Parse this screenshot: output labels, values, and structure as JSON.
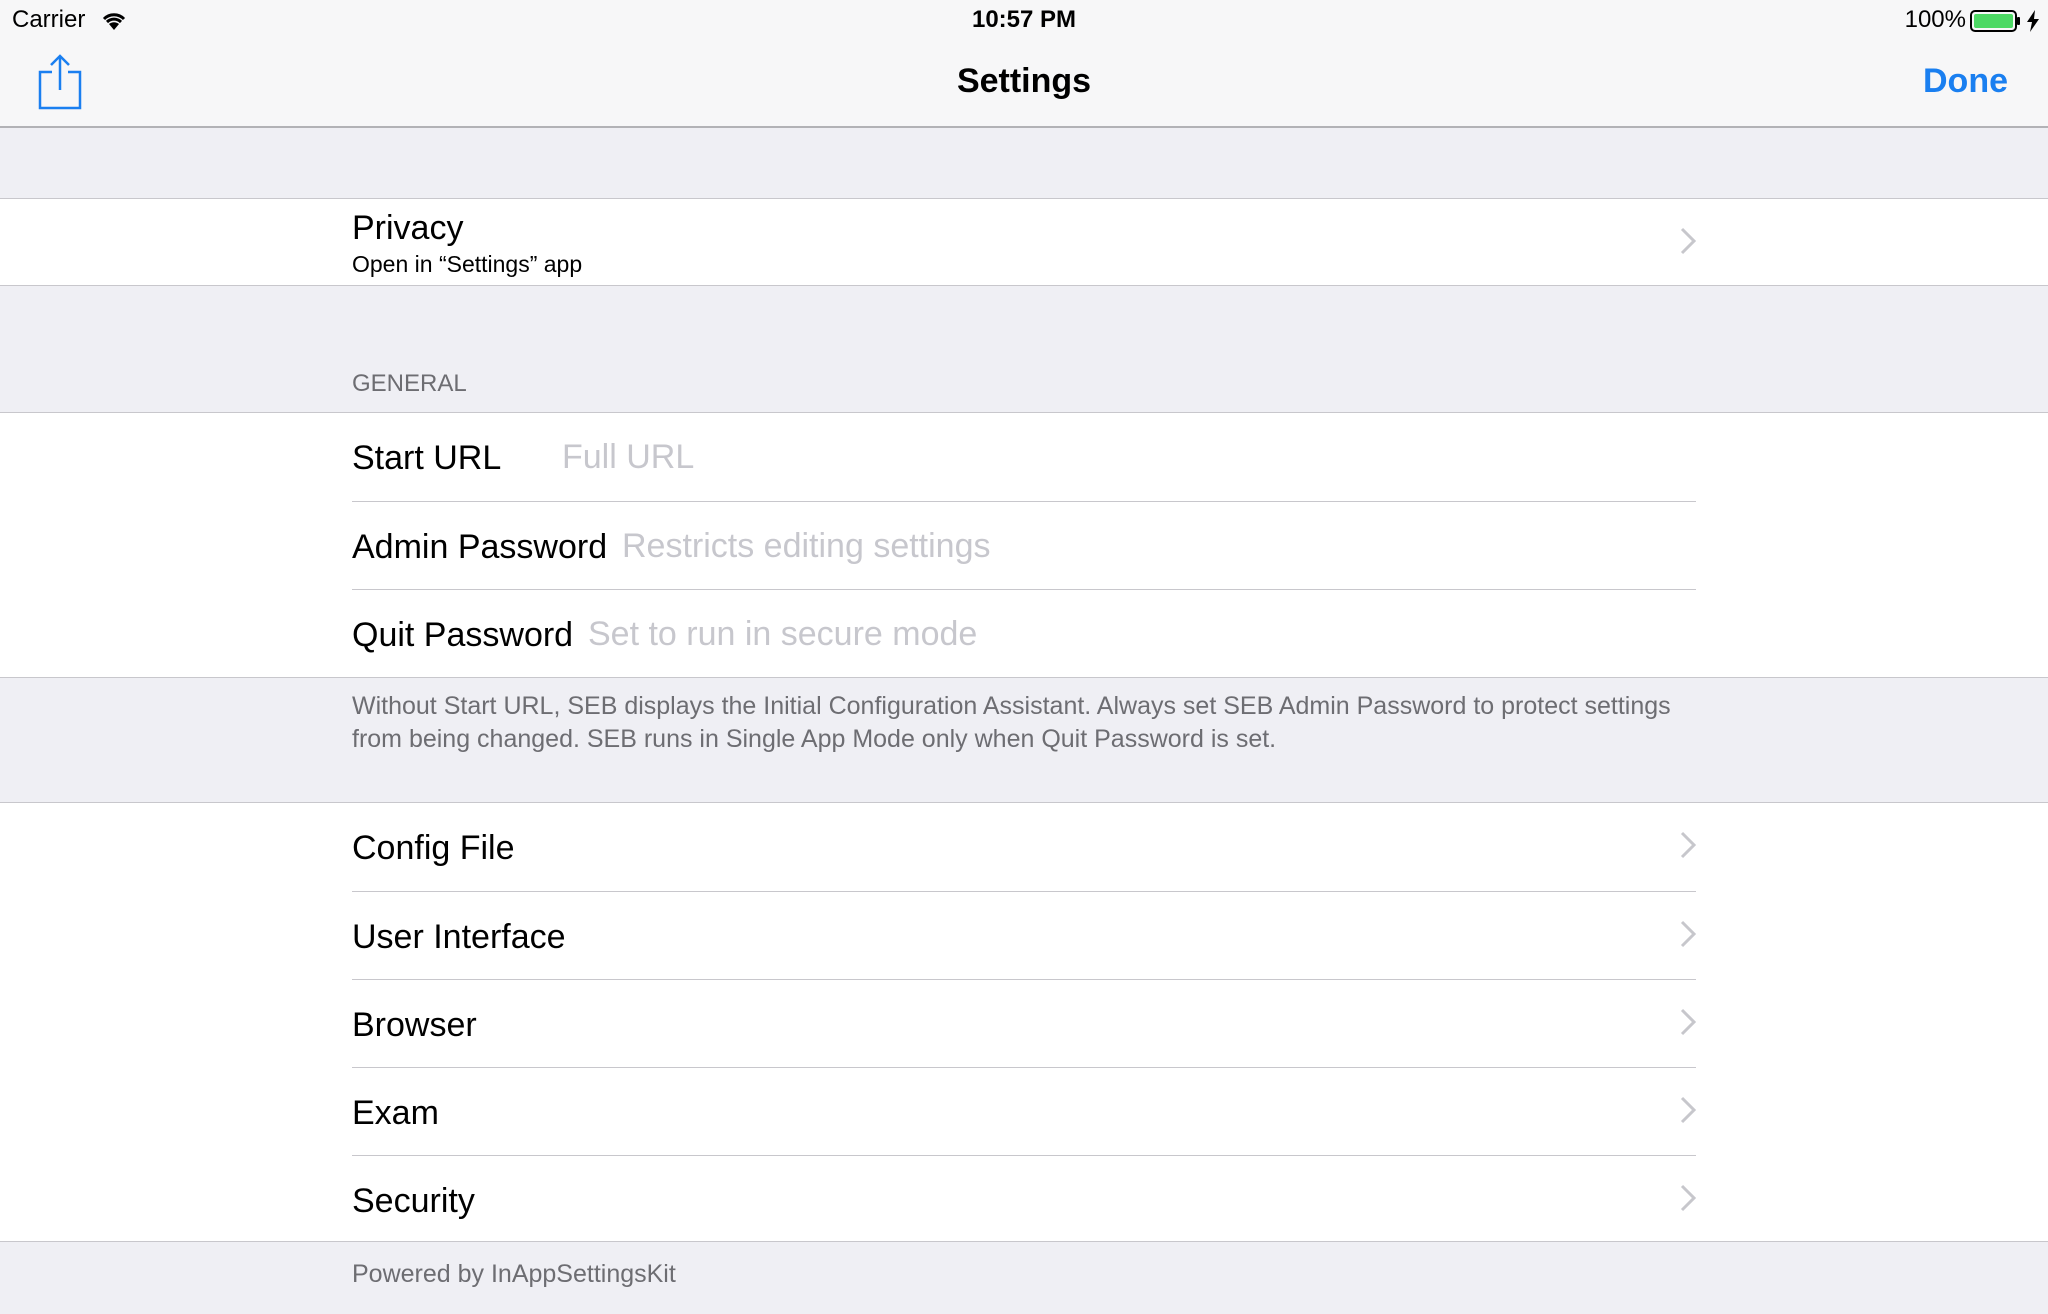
{
  "status_bar": {
    "carrier": "Carrier",
    "time": "10:57 PM",
    "battery": "100%",
    "icons": [
      "wifi-icon",
      "battery-icon",
      "charging-icon"
    ]
  },
  "nav": {
    "title": "Settings",
    "done_label": "Done",
    "share_icon": "share-icon"
  },
  "privacy": {
    "title": "Privacy",
    "subtitle": "Open in “Settings” app"
  },
  "general": {
    "header": "GENERAL",
    "fields": [
      {
        "label": "Start URL",
        "value": "",
        "placeholder": "Full URL"
      },
      {
        "label": "Admin Password",
        "value": "",
        "placeholder": "Restricts editing settings"
      },
      {
        "label": "Quit Password",
        "value": "",
        "placeholder": "Set to run in secure mode"
      }
    ],
    "footer": "Without Start URL, SEB displays the Initial Configuration Assistant. Always set SEB Admin Password to protect settings from being changed. SEB runs in Single App Mode only when Quit Password is set."
  },
  "sections": {
    "items": [
      {
        "label": "Config File"
      },
      {
        "label": "User Interface"
      },
      {
        "label": "Browser"
      },
      {
        "label": "Exam"
      },
      {
        "label": "Security"
      }
    ],
    "footer": "Powered by InAppSettingsKit"
  },
  "colors": {
    "accent": "#1a7ff0",
    "background": "#efeff4",
    "battery": "#4cd964",
    "separator": "#c8c7cc",
    "secondary_text": "#6d6d72",
    "placeholder": "#c7c7cd"
  }
}
